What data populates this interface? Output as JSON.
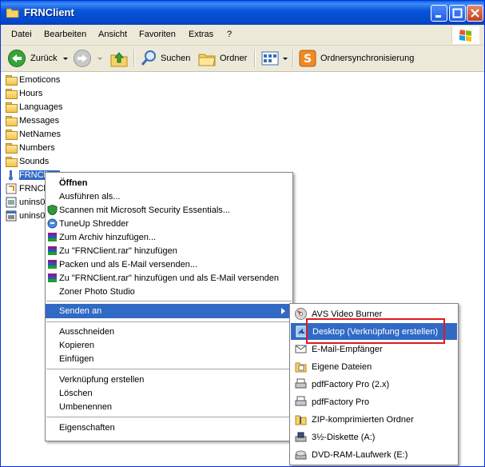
{
  "window": {
    "title": "FRNClient"
  },
  "menubar": [
    "Datei",
    "Bearbeiten",
    "Ansicht",
    "Favoriten",
    "Extras",
    "?"
  ],
  "toolbar": {
    "back": "Zurück",
    "search": "Suchen",
    "folders": "Ordner",
    "sync": "Ordnersynchronisierung"
  },
  "files": [
    {
      "name": "Emoticons",
      "type": "folder"
    },
    {
      "name": "Hours",
      "type": "folder"
    },
    {
      "name": "Languages",
      "type": "folder"
    },
    {
      "name": "Messages",
      "type": "folder"
    },
    {
      "name": "NetNames",
      "type": "folder"
    },
    {
      "name": "Numbers",
      "type": "folder"
    },
    {
      "name": "Sounds",
      "type": "folder"
    },
    {
      "name": "FRNClient",
      "type": "app",
      "selected": true
    },
    {
      "name": "FRNCli",
      "type": "app2"
    },
    {
      "name": "unins0",
      "type": "dat"
    },
    {
      "name": "unins0",
      "type": "exe"
    }
  ],
  "context_menu": {
    "open": "Öffnen",
    "run_as": "Ausführen als...",
    "scan": "Scannen mit Microsoft Security Essentials...",
    "shredder": "TuneUp Shredder",
    "archive": "Zum Archiv hinzufügen...",
    "add_rar": "Zu \"FRNClient.rar\" hinzufügen",
    "pack_email": "Packen und als E-Mail versenden...",
    "add_rar_email": "Zu \"FRNClient.rar\" hinzufügen und als E-Mail versenden",
    "zoner": "Zoner Photo Studio",
    "send_to": "Senden an",
    "cut": "Ausschneiden",
    "copy": "Kopieren",
    "paste": "Einfügen",
    "shortcut": "Verknüpfung erstellen",
    "delete": "Löschen",
    "rename": "Umbenennen",
    "properties": "Eigenschaften"
  },
  "send_to_menu": {
    "avs": "AVS Video Burner",
    "desktop": "Desktop (Verknüpfung erstellen)",
    "email": "E-Mail-Empfänger",
    "documents": "Eigene Dateien",
    "pdf2": "pdfFactory Pro (2.x)",
    "pdf": "pdfFactory Pro",
    "zip": "ZIP-komprimierten Ordner",
    "floppy": "3½-Diskette (A:)",
    "dvd": "DVD-RAM-Laufwerk (E:)"
  }
}
